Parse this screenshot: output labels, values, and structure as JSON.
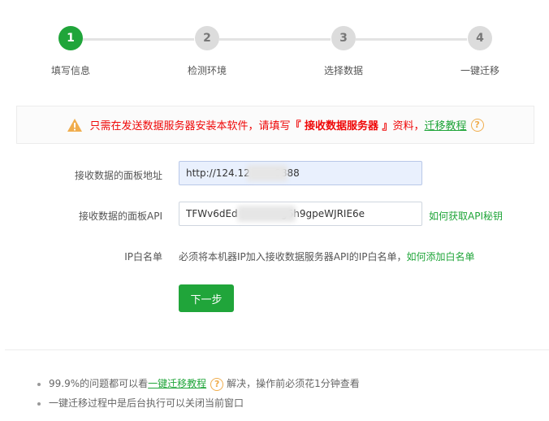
{
  "steps": [
    {
      "number": "1",
      "label": "填写信息",
      "active": true
    },
    {
      "number": "2",
      "label": "检测环境",
      "active": false
    },
    {
      "number": "3",
      "label": "选择数据",
      "active": false
    },
    {
      "number": "4",
      "label": "一键迁移",
      "active": false
    }
  ],
  "alert": {
    "icon": "warning-triangle-icon",
    "text_prefix": "只需在发送数据服务器安装本软件，请填写",
    "highlight": "『 接收数据服务器 』",
    "text_suffix": "资料，",
    "link": "迁移教程",
    "help_icon": "?"
  },
  "form": {
    "panel_address": {
      "label": "接收数据的面板地址",
      "value": "http://124.12        8888"
    },
    "panel_api": {
      "label": "接收数据的面板API",
      "value": "TFWv6dEd              g6h9gpeWJRIE6e",
      "help_link": "如何获取API秘钥"
    },
    "ip_whitelist": {
      "label": "IP白名单",
      "note": "必须将本机器IP加入接收数据服务器API的IP白名单，",
      "link": "如何添加白名单"
    },
    "next_button": "下一步"
  },
  "tips": [
    {
      "prefix": "99.9%的问题都可以看",
      "link": "一键迁移教程",
      "help_icon": "?",
      "suffix": "解决，操作前必须花1分钟查看"
    },
    {
      "text": "一键迁移过程中是后台执行可以关闭当前窗口"
    }
  ],
  "colors": {
    "accent": "#20a53a",
    "alert_red": "#ef0808",
    "help_orange": "#f0ad4e",
    "step_inactive": "#dcdcdc"
  }
}
